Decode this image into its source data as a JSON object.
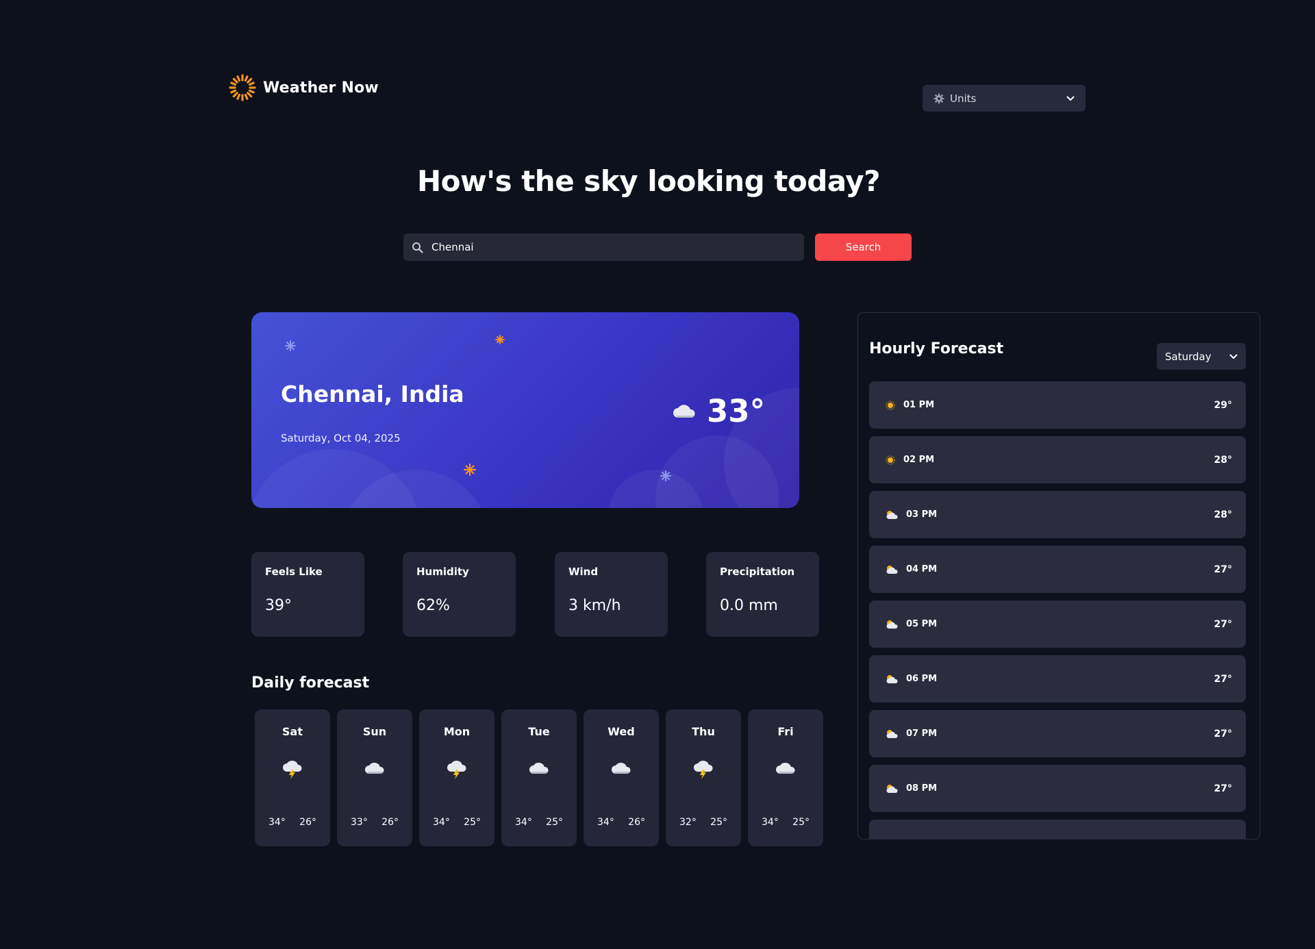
{
  "app": {
    "name": "Weather Now",
    "logo_icon": "sun-icon",
    "accent": "#f5464a"
  },
  "header": {
    "units_label": "Units",
    "units_icon": "gear-icon"
  },
  "hero": {
    "headline": "How's the sky looking today?"
  },
  "search": {
    "value": "Chennai",
    "button_label": "Search"
  },
  "current": {
    "location": "Chennai, India",
    "date": "Saturday, Oct 04, 2025",
    "temperature": "33°",
    "condition_icon": "cloud-icon"
  },
  "stats": [
    {
      "label": "Feels Like",
      "value": "39°"
    },
    {
      "label": "Humidity",
      "value": "62%"
    },
    {
      "label": "Wind",
      "value": "3 km/h"
    },
    {
      "label": "Precipitation",
      "value": "0.0 mm"
    }
  ],
  "daily": {
    "title": "Daily forecast",
    "days": [
      {
        "day": "Sat",
        "icon": "storm-icon",
        "high": "34°",
        "low": "26°"
      },
      {
        "day": "Sun",
        "icon": "cloud-icon",
        "high": "33°",
        "low": "26°"
      },
      {
        "day": "Mon",
        "icon": "storm-icon",
        "high": "34°",
        "low": "25°"
      },
      {
        "day": "Tue",
        "icon": "cloud-icon",
        "high": "34°",
        "low": "25°"
      },
      {
        "day": "Wed",
        "icon": "cloud-icon",
        "high": "34°",
        "low": "26°"
      },
      {
        "day": "Thu",
        "icon": "storm-icon",
        "high": "32°",
        "low": "25°"
      },
      {
        "day": "Fri",
        "icon": "cloud-icon",
        "high": "34°",
        "low": "25°"
      }
    ]
  },
  "hourly": {
    "title": "Hourly Forecast",
    "selected_day": "Saturday",
    "hours": [
      {
        "time": "01 PM",
        "icon": "sun-icon",
        "temp": "29°"
      },
      {
        "time": "02 PM",
        "icon": "sun-icon",
        "temp": "28°"
      },
      {
        "time": "03 PM",
        "icon": "partly-cloudy-icon",
        "temp": "28°"
      },
      {
        "time": "04 PM",
        "icon": "partly-cloudy-icon",
        "temp": "27°"
      },
      {
        "time": "05 PM",
        "icon": "partly-cloudy-icon",
        "temp": "27°"
      },
      {
        "time": "06 PM",
        "icon": "partly-cloudy-icon",
        "temp": "27°"
      },
      {
        "time": "07 PM",
        "icon": "partly-cloudy-icon",
        "temp": "27°"
      },
      {
        "time": "08 PM",
        "icon": "partly-cloudy-icon",
        "temp": "27°"
      }
    ]
  }
}
